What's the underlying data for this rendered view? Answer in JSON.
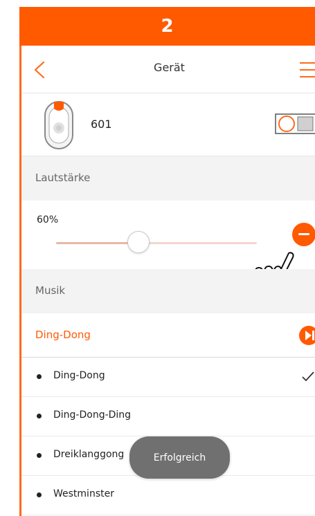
{
  "step": {
    "number": "2"
  },
  "header": {
    "title": "Gerät"
  },
  "device": {
    "name": "601"
  },
  "volume": {
    "section_label": "Lautstärke",
    "value_text": "60%",
    "level_fraction": 0.43
  },
  "music": {
    "section_label": "Musik",
    "selected": "Ding-Dong",
    "items": [
      {
        "label": "Ding-Dong",
        "checked": true
      },
      {
        "label": "Ding-Dong-Ding",
        "checked": false
      },
      {
        "label": "Dreiklanggong",
        "checked": false
      },
      {
        "label": "Westminster",
        "checked": false
      }
    ]
  },
  "toast": {
    "text": "Erfolgreich"
  },
  "colors": {
    "accent": "#ff5a00",
    "section_bg": "#f3f3f3",
    "toast_bg": "#707070"
  },
  "icons": [
    "back-arrow-icon",
    "menu-icon",
    "doorbell-device-icon",
    "toggle-switch-icon",
    "minus-icon",
    "pointing-hand-icon",
    "play-next-icon",
    "checkmark-icon"
  ]
}
